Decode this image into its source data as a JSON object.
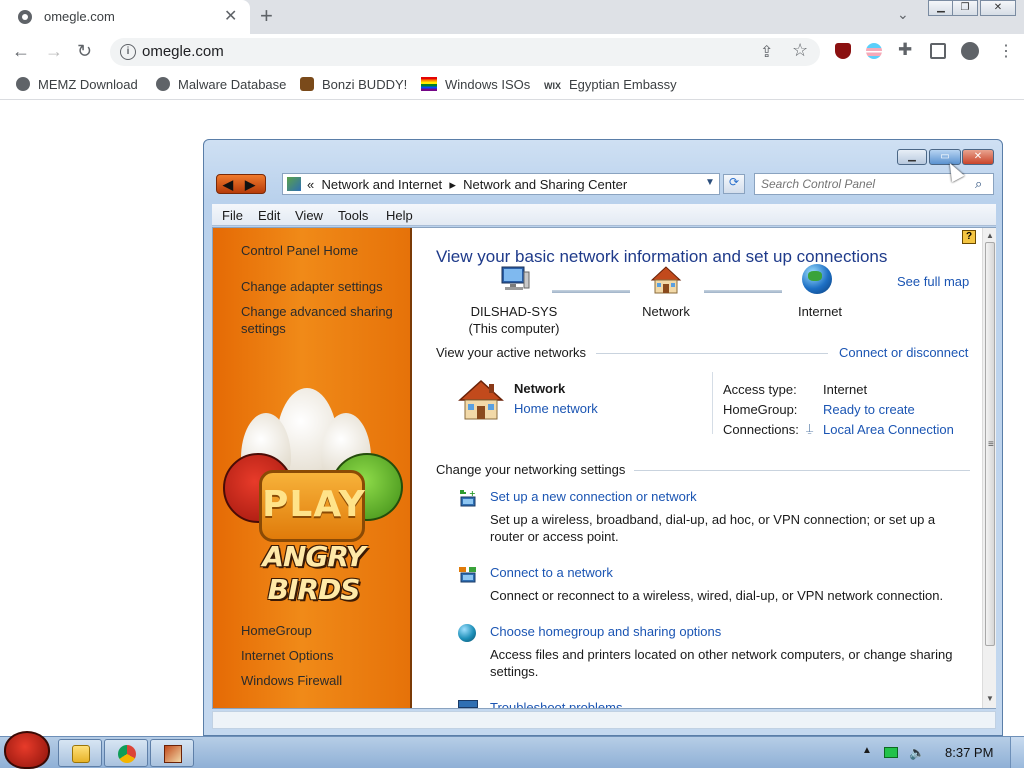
{
  "browser": {
    "tab_title": "omegle.com",
    "url": "omegle.com",
    "bookmarks": [
      "MEMZ Download",
      "Malware Database",
      "Bonzi BUDDY!",
      "Windows ISOs",
      "Egyptian Embassy"
    ],
    "bookmark_wix": "WIX"
  },
  "window": {
    "breadcrumb_marker": "«",
    "breadcrumb": [
      "Network and Internet",
      "Network and Sharing Center"
    ],
    "breadcrumb_sep": "▸",
    "search_placeholder": "Search Control Panel",
    "menu": [
      "File",
      "Edit",
      "View",
      "Tools",
      "Help"
    ],
    "left_links": [
      "Control Panel Home",
      "Change adapter settings",
      "Change advanced sharing settings"
    ],
    "left_links_bottom": [
      "HomeGroup",
      "Internet Options",
      "Windows Firewall"
    ],
    "promo": {
      "play": "PLAY",
      "title": "ANGRY BIRDS"
    },
    "title": "View your basic network information and set up connections",
    "see_full_map": "See full map",
    "map": {
      "computer": "DILSHAD-SYS",
      "computer_sub": "(This computer)",
      "network": "Network",
      "internet": "Internet"
    },
    "active_networks_label": "View your active networks",
    "connect_disconnect": "Connect or disconnect",
    "active_network": {
      "name": "Network",
      "type": "Home network",
      "access_type_label": "Access type:",
      "access_type": "Internet",
      "homegroup_label": "HomeGroup:",
      "homegroup": "Ready to create",
      "connections_label": "Connections:",
      "connection": "Local Area Connection"
    },
    "change_settings_label": "Change your networking settings",
    "tasks": [
      {
        "title": "Set up a new connection or network",
        "desc": "Set up a wireless, broadband, dial-up, ad hoc, or VPN connection; or set up a router or access point."
      },
      {
        "title": "Connect to a network",
        "desc": "Connect or reconnect to a wireless, wired, dial-up, or VPN network connection."
      },
      {
        "title": "Choose homegroup and sharing options",
        "desc": "Access files and printers located on other network computers, or change sharing settings."
      },
      {
        "title": "Troubleshoot problems",
        "desc": ""
      }
    ]
  },
  "taskbar": {
    "clock": "8:37 PM"
  },
  "colors": {
    "accent_link": "#1b55b3",
    "left_pane": "#e87a0f",
    "title": "#1e3a8a"
  }
}
